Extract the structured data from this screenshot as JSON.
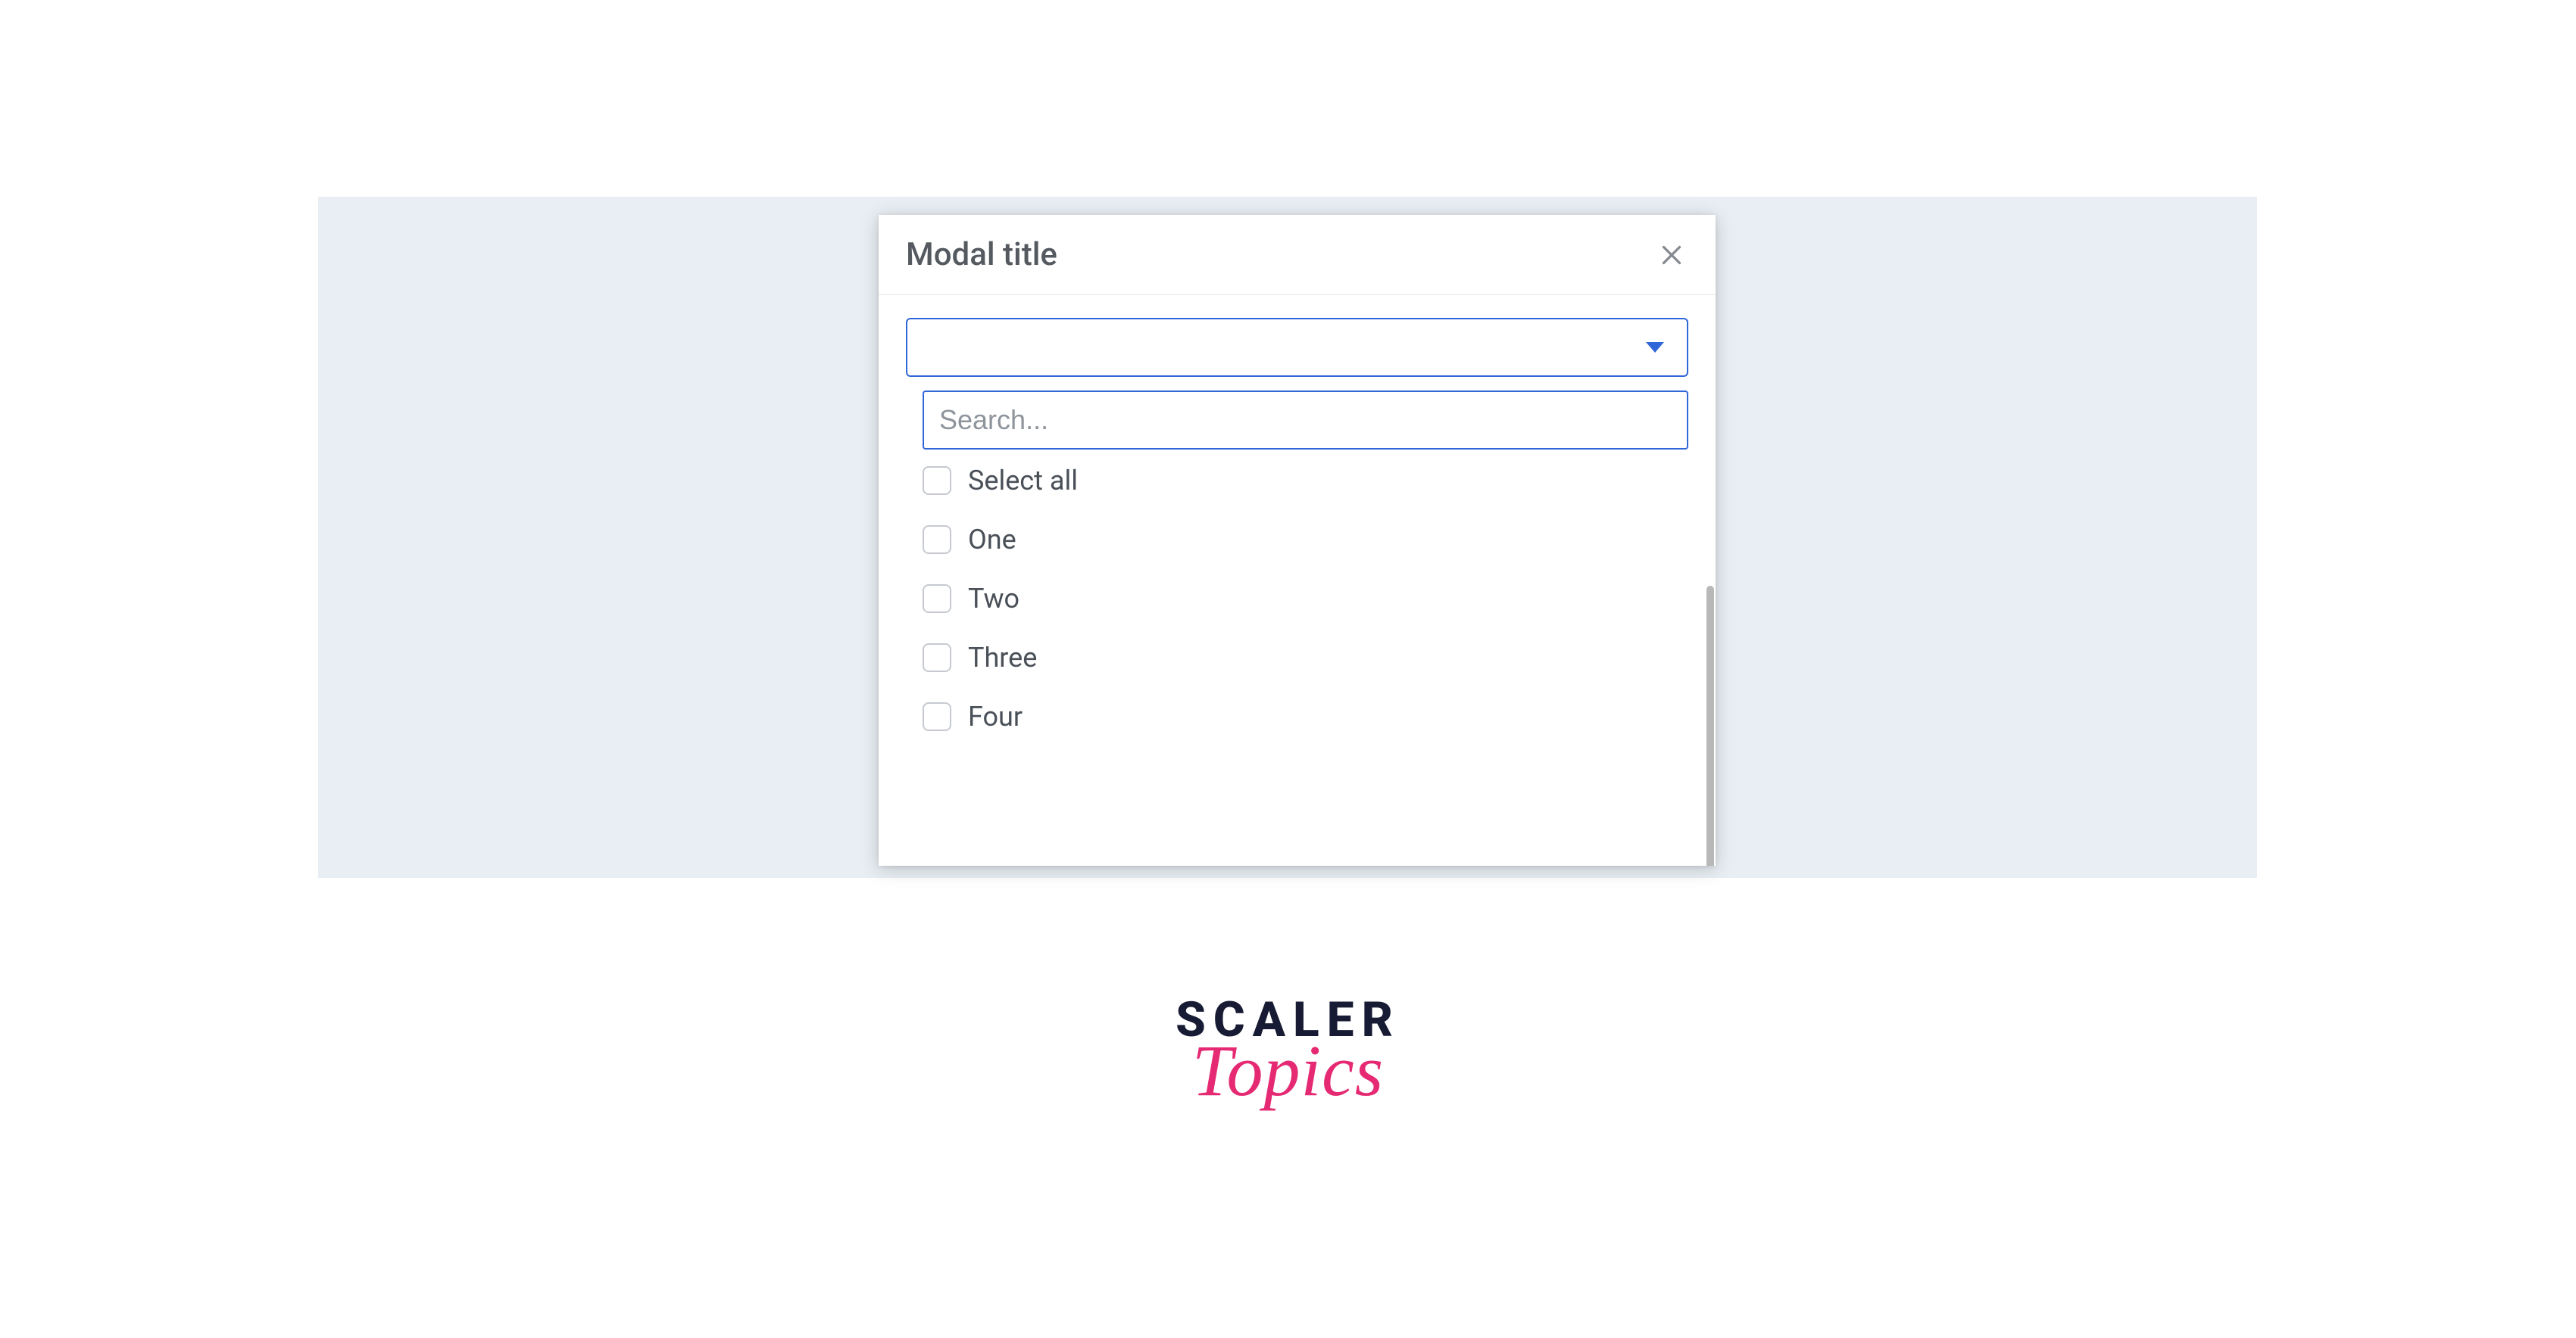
{
  "modal": {
    "title": "Modal title",
    "close_icon": "close-icon",
    "select": {
      "value": ""
    },
    "search": {
      "placeholder": "Search..."
    },
    "options": [
      {
        "label": "Select all",
        "checked": false
      },
      {
        "label": "One",
        "checked": false
      },
      {
        "label": "Two",
        "checked": false
      },
      {
        "label": "Three",
        "checked": false
      },
      {
        "label": "Four",
        "checked": false
      }
    ]
  },
  "brand": {
    "line1": "SCALER",
    "line2": "Topics"
  },
  "colors": {
    "panel": "#e8eef3",
    "primary": "#2f66d8",
    "text": "#4a5058",
    "brand_dark": "#171b33",
    "brand_accent": "#e52972"
  }
}
